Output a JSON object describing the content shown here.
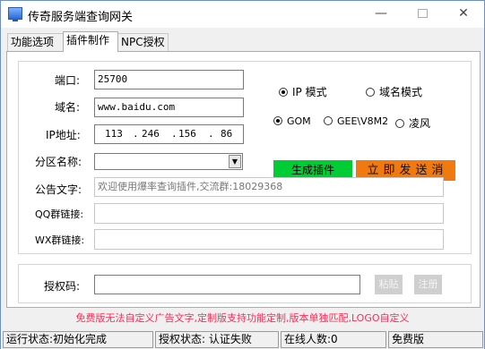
{
  "window": {
    "title": "传奇服务端查询网关",
    "minimize": "—",
    "close": "✕"
  },
  "tabs": [
    "功能选项",
    "插件制作",
    "NPC授权"
  ],
  "form": {
    "port_label": "端口:",
    "port_value": "25700",
    "domain_label": "域名:",
    "domain_value": "www.baidu.com",
    "ip_label": "IP地址:",
    "ip_octets": [
      "113",
      "246",
      "156",
      "86"
    ],
    "ip_dot": ".",
    "region_label": "分区名称:",
    "region_value": "",
    "notice_label": "公告文字:",
    "notice_placeholder": "欢迎使用爆率查询插件,交流群:18029368",
    "qq_label": "QQ群链接:",
    "qq_value": "",
    "wx_label": "WX群链接:",
    "wx_value": ""
  },
  "mode_options": [
    {
      "label": "IP 模式",
      "checked": true
    },
    {
      "label": "域名模式",
      "checked": false
    }
  ],
  "engine_options": [
    {
      "label": "GOM",
      "checked": true
    },
    {
      "label": "GEE\\V8M2",
      "checked": false
    },
    {
      "label": "凌风",
      "checked": false
    }
  ],
  "buttons": {
    "generate": "生成插件",
    "send": "立即发送消息",
    "paste": "粘贴",
    "register": "注册"
  },
  "auth": {
    "label": "授权码:",
    "value": ""
  },
  "notice_text": "免费版无法自定义广告文字,定制版支持功能定制,版本单独匹配,LOGO自定义",
  "status": {
    "run": "运行状态:初始化完成",
    "auth": "授权状态: 认证失败",
    "online": "在线人数:0",
    "edition": "免费版"
  },
  "colors": {
    "generate_button": "#00cc33",
    "send_button": "#f07a10",
    "notice_text": "#ff2a55"
  }
}
